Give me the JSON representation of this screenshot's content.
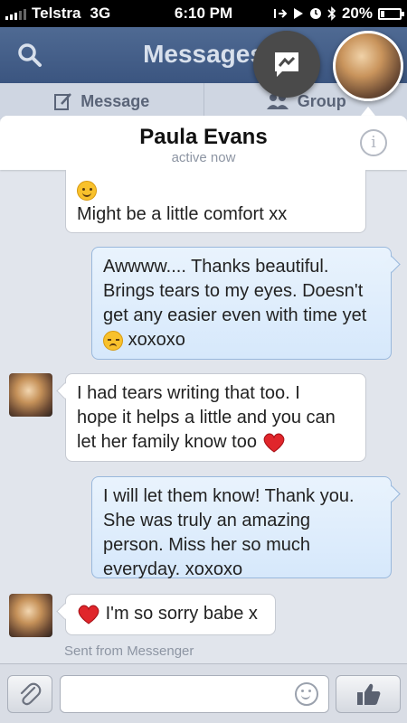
{
  "status_bar": {
    "carrier": "Telstra",
    "network": "3G",
    "time": "6:10 PM",
    "battery": "20%",
    "battery_level": 0.2
  },
  "nav": {
    "title": "Messages",
    "search_icon": "search-icon"
  },
  "tabs": [
    {
      "label": "Message",
      "icon": "compose-icon"
    },
    {
      "label": "Group",
      "icon": "group-icon"
    }
  ],
  "conversation": {
    "name": "Paula Evans",
    "status": "active now"
  },
  "messages": [
    {
      "direction": "in",
      "text": "Might be a little comfort xx",
      "emoji": "smile"
    },
    {
      "direction": "out",
      "lines": [
        "Awwww.... Thanks beautiful.",
        "Brings tears to my eyes. Doesn't",
        "get any easier even with time yet"
      ],
      "tail": "xoxoxo",
      "emoji": "sad"
    },
    {
      "direction": "in",
      "lines": [
        "I had tears writing that too. I",
        "hope it helps a little and you can",
        "let her family know too"
      ],
      "emoji": "heart"
    },
    {
      "direction": "out",
      "lines": [
        "I will let them know! Thank you.",
        "She was truly an amazing",
        "person. Miss her so much",
        "everyday. xoxoxo"
      ]
    },
    {
      "direction": "in",
      "text": "I'm so sorry babe x",
      "emoji": "heart"
    }
  ],
  "sent_from": "Sent from Messenger",
  "composer": {
    "placeholder": "",
    "value": ""
  },
  "colors": {
    "nav_bg": "#3b5580",
    "chat_bg": "#e1e5ec",
    "outgoing_bubble": "#d6e8fb",
    "incoming_bubble": "#ffffff",
    "heart": "#e0262b"
  }
}
